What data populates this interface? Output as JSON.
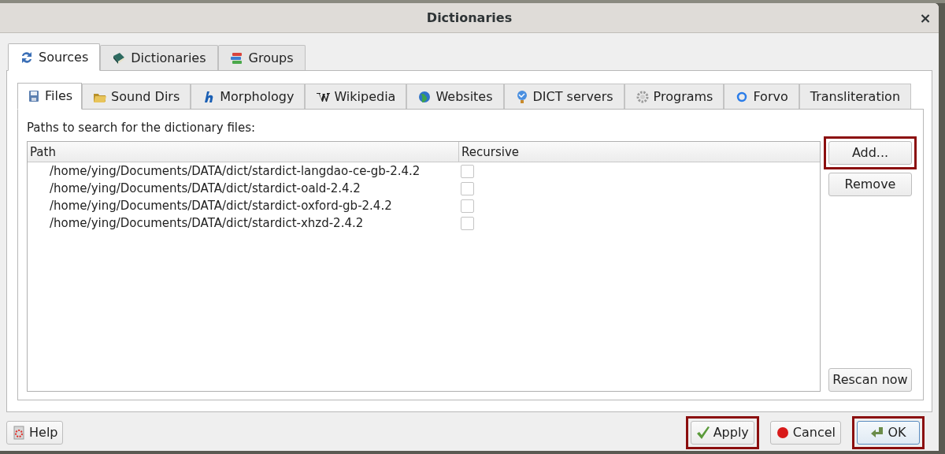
{
  "window": {
    "title": "Dictionaries",
    "close": "×"
  },
  "tabs": [
    {
      "label": "Sources",
      "selected": true
    },
    {
      "label": "Dictionaries",
      "selected": false
    },
    {
      "label": "Groups",
      "selected": false
    }
  ],
  "subtabs": [
    {
      "label": "Files",
      "selected": true
    },
    {
      "label": "Sound Dirs",
      "selected": false
    },
    {
      "label": "Morphology",
      "selected": false
    },
    {
      "label": "Wikipedia",
      "selected": false
    },
    {
      "label": "Websites",
      "selected": false
    },
    {
      "label": "DICT servers",
      "selected": false
    },
    {
      "label": "Programs",
      "selected": false
    },
    {
      "label": "Forvo",
      "selected": false
    },
    {
      "label": "Transliteration",
      "selected": false
    }
  ],
  "paths_label": "Paths to search for the dictionary files:",
  "table": {
    "columns": [
      "Path",
      "Recursive"
    ],
    "rows": [
      {
        "path": "/home/ying/Documents/DATA/dict/stardict-langdao-ce-gb-2.4.2",
        "recursive": false
      },
      {
        "path": "/home/ying/Documents/DATA/dict/stardict-oald-2.4.2",
        "recursive": false
      },
      {
        "path": "/home/ying/Documents/DATA/dict/stardict-oxford-gb-2.4.2",
        "recursive": false
      },
      {
        "path": "/home/ying/Documents/DATA/dict/stardict-xhzd-2.4.2",
        "recursive": false
      }
    ]
  },
  "side_buttons": [
    {
      "label": "Add...",
      "highlighted": true
    },
    {
      "label": "Remove",
      "highlighted": false
    }
  ],
  "rescan_button": {
    "label": "Rescan now"
  },
  "help_button": {
    "label": "Help"
  },
  "dialog_buttons": [
    {
      "label": "Apply",
      "highlighted": true
    },
    {
      "label": "Cancel",
      "highlighted": false
    },
    {
      "label": "OK",
      "highlighted": true
    }
  ]
}
